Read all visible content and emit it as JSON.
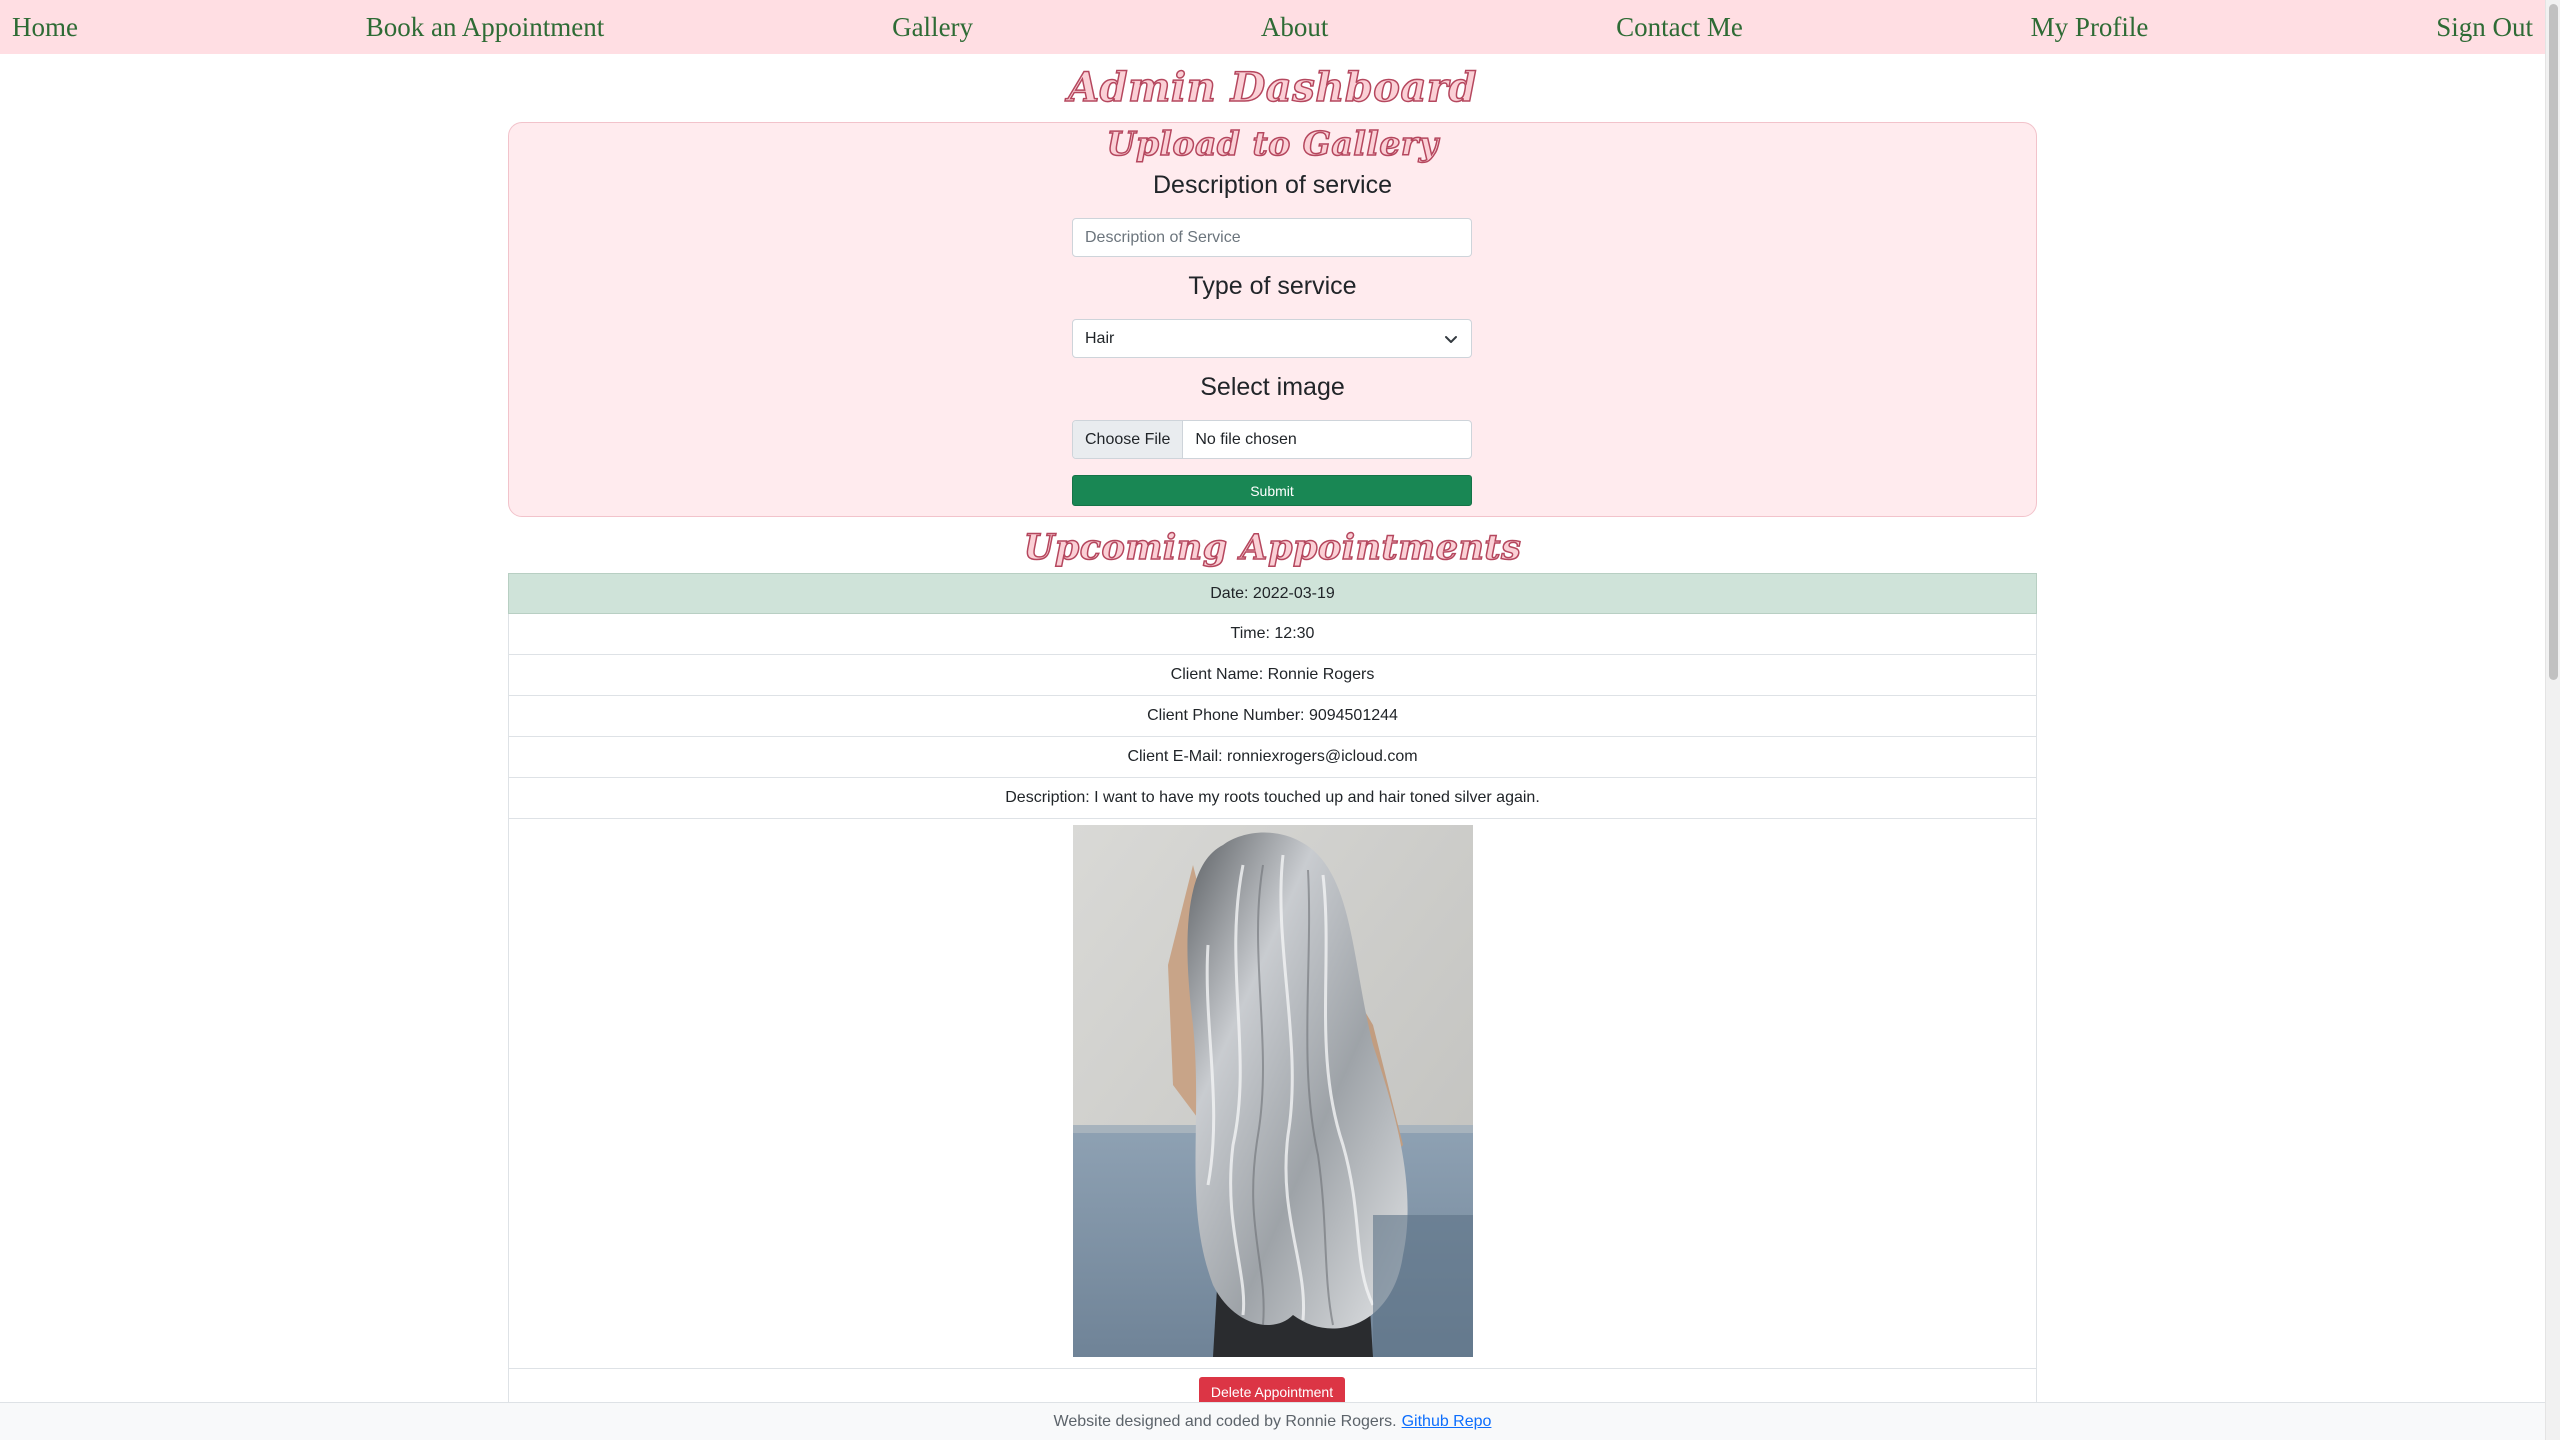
{
  "nav": {
    "home": "Home",
    "book": "Book an Appointment",
    "gallery": "Gallery",
    "about": "About",
    "contact": "Contact Me",
    "profile": "My Profile",
    "signout": "Sign Out"
  },
  "page_title": "Admin Dashboard",
  "upload": {
    "title": "Upload to Gallery",
    "description_label": "Description of service",
    "description_placeholder": "Description of Service",
    "description_value": "",
    "type_label": "Type of service",
    "type_selected": "Hair",
    "image_label": "Select image",
    "choose_file_label": "Choose File",
    "file_status": "No file chosen",
    "submit_label": "Submit"
  },
  "appointments": {
    "title": "Upcoming Appointments",
    "items": [
      {
        "date": "Date: 2022-03-19",
        "time": "Time: 12:30",
        "client_name": "Client Name: Ronnie Rogers",
        "client_phone": "Client Phone Number: 9094501244",
        "client_email": "Client E-Mail: ronniexrogers@icloud.com",
        "description": "Description: I want to have my roots touched up and hair toned silver again.",
        "delete_label": "Delete Appointment"
      }
    ]
  },
  "footer": {
    "text": "Website designed and coded by Ronnie Rogers.",
    "link_label": "Github Repo"
  },
  "colors": {
    "navbar_bg": "#ffdee3",
    "nav_text": "#2e6b35",
    "card_bg": "#ffebee",
    "submit_bg": "#198754",
    "date_row_bg": "#cfe3d9",
    "delete_bg": "#dc3545",
    "link": "#0d6efd"
  }
}
